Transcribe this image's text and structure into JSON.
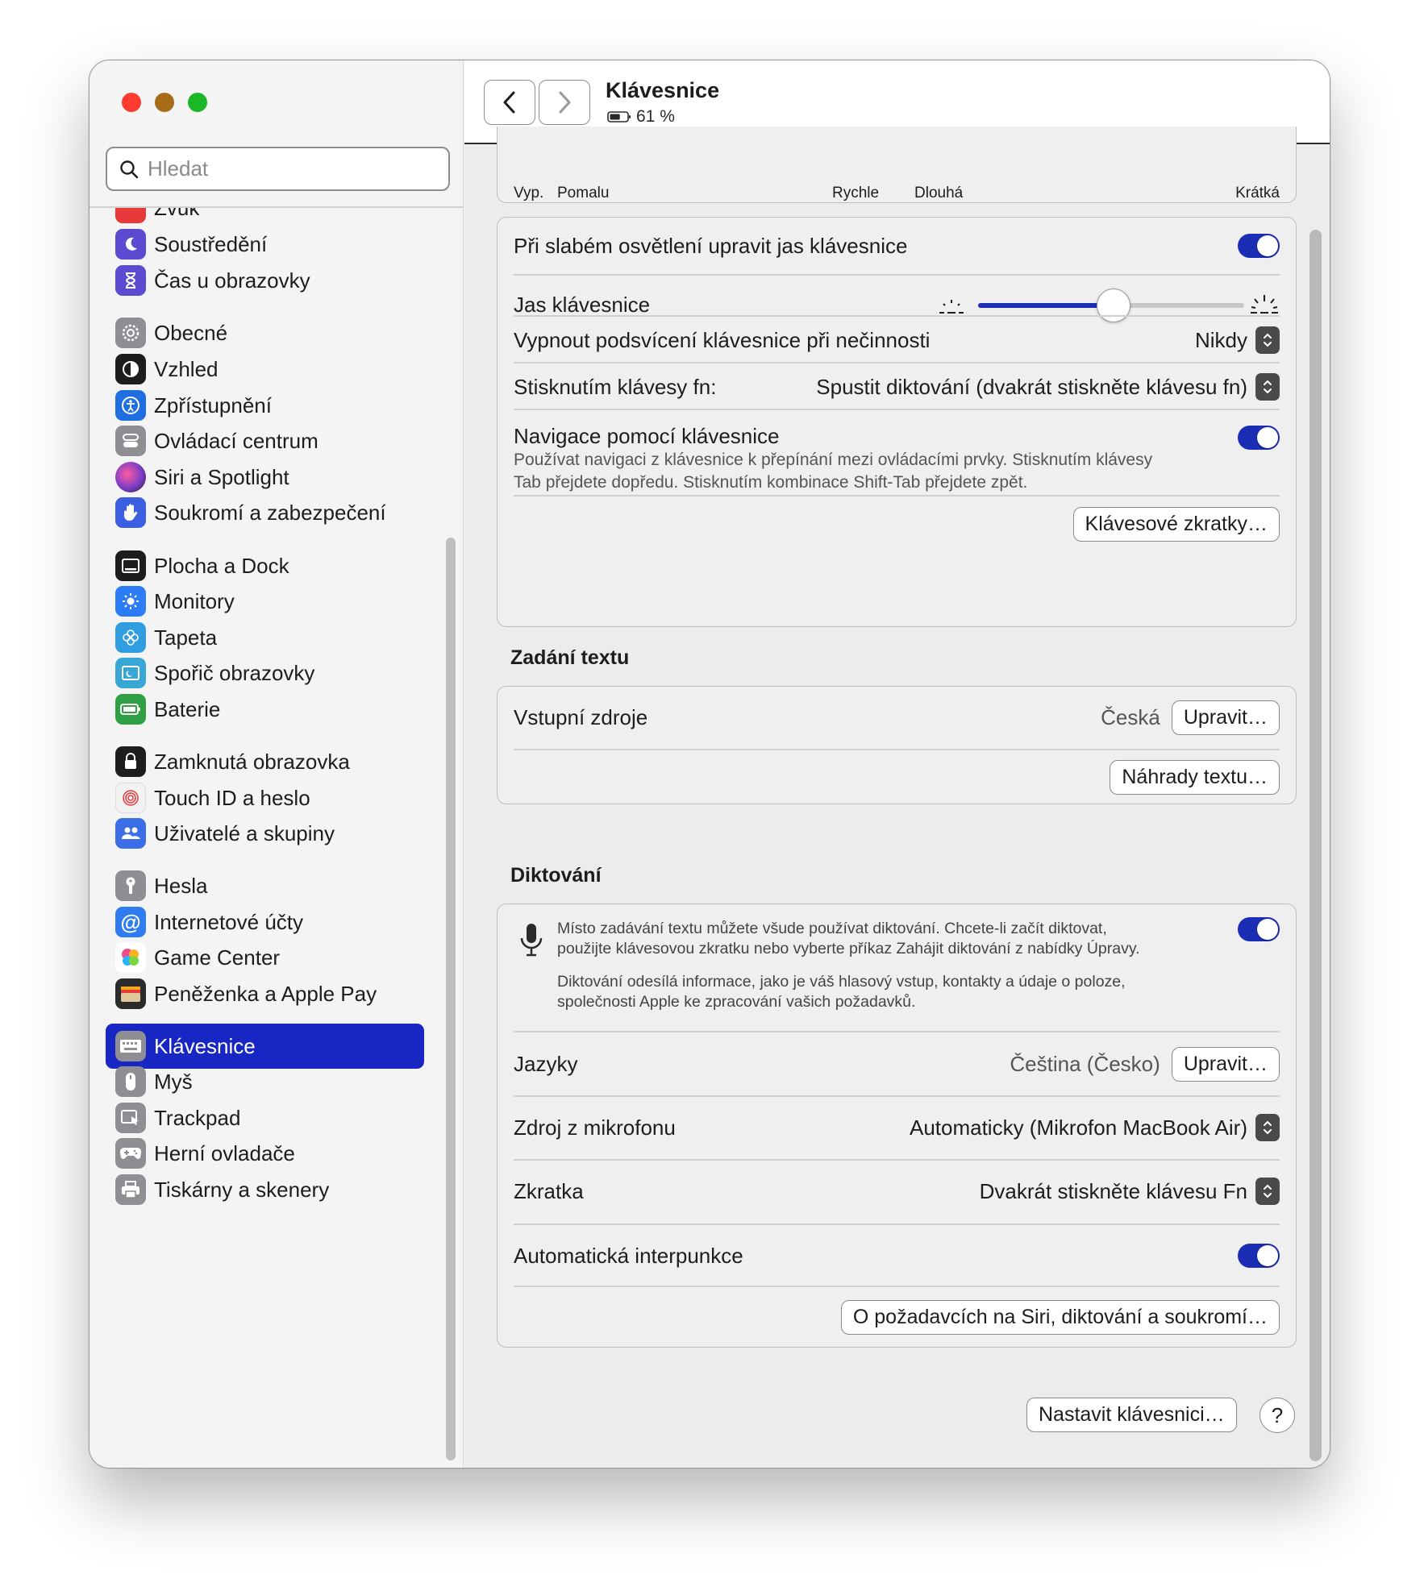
{
  "window": {
    "title": "Klávesnice",
    "battery_text": "61 %",
    "battery_level": 0.61
  },
  "sidebar": {
    "search_placeholder": "Hledat",
    "partial_top_label": "Zvuk",
    "items": [
      {
        "label": "Soustředění",
        "icon": "moon-icon",
        "color": "#5c4bd1"
      },
      {
        "label": "Čas u obrazovky",
        "icon": "hourglass-icon",
        "color": "#5c4bd1"
      },
      {
        "label": "Obecné",
        "icon": "gear-icon",
        "color": "#8e8e93"
      },
      {
        "label": "Vzhled",
        "icon": "appearance-icon",
        "color": "#1d1d1f"
      },
      {
        "label": "Zpřístupnění",
        "icon": "accessibility-icon",
        "color": "#1f6fe0"
      },
      {
        "label": "Ovládací centrum",
        "icon": "toggles-icon",
        "color": "#8e8e93"
      },
      {
        "label": "Siri a Spotlight",
        "icon": "siri-icon",
        "color": "#7a3cc7"
      },
      {
        "label": "Soukromí a zabezpečení",
        "icon": "hand-icon",
        "color": "#3b5fe0"
      },
      {
        "label": "Plocha a Dock",
        "icon": "dock-icon",
        "color": "#1d1d1f"
      },
      {
        "label": "Monitory",
        "icon": "sun-icon",
        "color": "#2c7cf6"
      },
      {
        "label": "Tapeta",
        "icon": "flower-icon",
        "color": "#2f9de0"
      },
      {
        "label": "Spořič obrazovky",
        "icon": "screensaver-icon",
        "color": "#39a7d6"
      },
      {
        "label": "Baterie",
        "icon": "battery-icon",
        "color": "#2ea043"
      },
      {
        "label": "Zamknutá obrazovka",
        "icon": "lock-icon",
        "color": "#1d1d1f"
      },
      {
        "label": "Touch ID a heslo",
        "icon": "fingerprint-icon",
        "color": "#f2f2f2"
      },
      {
        "label": "Uživatelé a skupiny",
        "icon": "users-icon",
        "color": "#3a6de6"
      },
      {
        "label": "Hesla",
        "icon": "key-icon",
        "color": "#8e8e93"
      },
      {
        "label": "Internetové účty",
        "icon": "at-icon",
        "color": "#2f7cf0"
      },
      {
        "label": "Game Center",
        "icon": "gamecenter-icon",
        "color": "#ffffff"
      },
      {
        "label": "Peněženka a Apple Pay",
        "icon": "wallet-icon",
        "color": "#2b2b2b"
      },
      {
        "label": "Klávesnice",
        "icon": "keyboard-icon",
        "color": "#8e8e93"
      },
      {
        "label": "Myš",
        "icon": "mouse-icon",
        "color": "#8e8e93"
      },
      {
        "label": "Trackpad",
        "icon": "trackpad-icon",
        "color": "#8e8e93"
      },
      {
        "label": "Herní ovladače",
        "icon": "gamepad-icon",
        "color": "#8e8e93"
      },
      {
        "label": "Tiskárny a skenery",
        "icon": "printer-icon",
        "color": "#8e8e93"
      }
    ],
    "active_label": "Klávesnice"
  },
  "main": {
    "top_scale": {
      "left_a": "Vyp.",
      "left_b": "Pomalu",
      "mid_a": "Rychle",
      "mid_b": "Dlouhá",
      "right": "Krátká"
    },
    "backlight": {
      "auto_brightness_label": "Při slabém osvětlení upravit jas klávesnice",
      "auto_brightness_on": true,
      "brightness_label": "Jas klávesnice",
      "brightness_value": 0.51,
      "idle_off_label": "Vypnout podsvícení klávesnice při nečinnosti",
      "idle_off_value": "Nikdy",
      "fn_label": "Stisknutím klávesy fn:",
      "fn_value": "Spustit diktování (dvakrát stiskněte klávesu fn)",
      "nav_label": "Navigace pomocí klávesnice",
      "nav_desc_1": "Používat navigaci z klávesnice k přepínání mezi ovládacími prvky. Stisknutím klávesy",
      "nav_desc_2": "Tab přejdete dopředu. Stisknutím kombinace Shift-Tab přejdete zpět.",
      "nav_on": true,
      "shortcuts_button": "Klávesové zkratky…"
    },
    "text_input": {
      "section_title": "Zadání textu",
      "sources_label": "Vstupní zdroje",
      "sources_value": "Česká",
      "edit_button": "Upravit…",
      "replacements_button": "Náhrady textu…"
    },
    "dictation": {
      "section_title": "Diktování",
      "desc_1": "Místo zadávání textu můžete všude používat diktování. Chcete-li začít diktovat,",
      "desc_2": "použijte klávesovou zkratku nebo vyberte příkaz Zahájit diktování z nabídky Úpravy.",
      "desc_3": "Diktování odesílá informace, jako je váš hlasový vstup, kontakty a údaje o poloze,",
      "desc_4": "společnosti Apple ke zpracování vašich požadavků.",
      "dictation_on": true,
      "languages_label": "Jazyky",
      "languages_value": "Čeština (Česko)",
      "languages_button": "Upravit…",
      "mic_label": "Zdroj z mikrofonu",
      "mic_value": "Automaticky (Mikrofon MacBook Air)",
      "shortcut_label": "Zkratka",
      "shortcut_value": "Dvakrát stiskněte klávesu Fn",
      "auto_punct_label": "Automatická interpunkce",
      "auto_punct_on": true,
      "privacy_button": "O požadavcích na Siri, diktování a soukromí…"
    },
    "footer": {
      "setup_button": "Nastavit klávesnici…",
      "help_button": "?"
    }
  }
}
